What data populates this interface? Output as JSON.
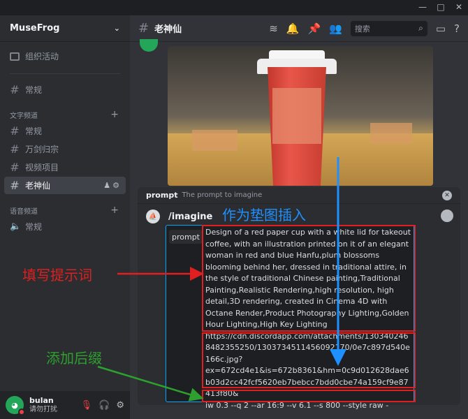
{
  "window": {
    "controls": [
      "—",
      "□",
      "✕"
    ]
  },
  "server": {
    "name": "MuseFrog"
  },
  "sidebar": {
    "events_label": "组织活动",
    "top_channel": "常规",
    "text_category": "文字频道",
    "text_channels": [
      "常规",
      "万剑归宗",
      "视频项目",
      "老神仙"
    ],
    "voice_category": "语音频道",
    "voice_channels": [
      "常规"
    ]
  },
  "user": {
    "name": "bulan",
    "status": "请勿打扰"
  },
  "header": {
    "channel": "老神仙",
    "search_placeholder": "搜索"
  },
  "command": {
    "param_name": "prompt",
    "param_desc": "The prompt to imagine",
    "name": "/imagine",
    "option_label": "prompt",
    "prompt_text": "Design of a red paper cup with a white lid for takeout coffee, with an illustration printed on it of an elegant woman in red and blue Hanfu,plum blossoms blooming behind her, dressed in traditional attire, in the style of traditional Chinese painting,Traditional Painting,Realistic Rendering,high resolution, high detail,3D rendering, created in Cinema 4D with Octane Render,Product Photography Lighting,Golden Hour Lighting,High Key Lighting",
    "image_url": "https://cdn.discordapp.com/attachments/1303402468482355250/1303734511456092170/0e7c897d540e166c.jpg?ex=672cd4e1&is=672b8361&hm=0c9d012628dae6b03d2cc42fcf5620eb7bebcc7bdd0cbe74a159cf9e87413f80&",
    "suffix": "iw 0.3 --q 2 --ar 16:9 --v 6.1 --s 800 --style raw -"
  },
  "annotations": {
    "image_note": "作为垫图插入",
    "prompt_note": "填写提示词",
    "suffix_note": "添加后缀",
    "colors": {
      "red": "#e02020",
      "blue": "#1e90ff",
      "green": "#2ea02e"
    }
  },
  "colors": {
    "accent_blue": "#00a8fc",
    "online_green": "#23a55a",
    "dnd_red": "#f23f43"
  }
}
